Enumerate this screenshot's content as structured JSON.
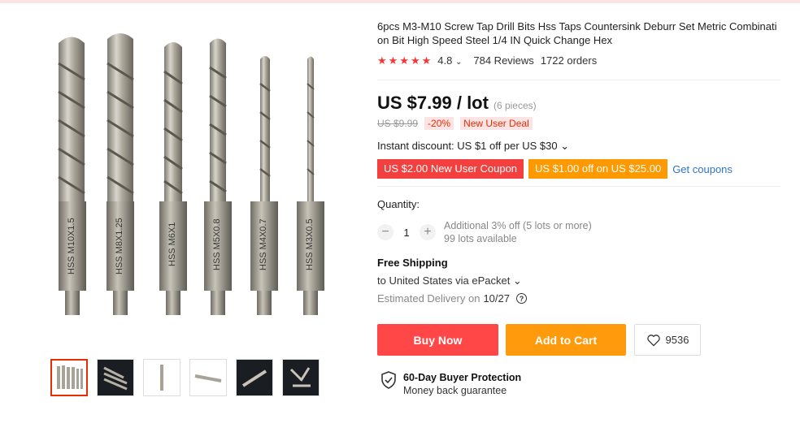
{
  "product": {
    "title": "6pcs M3-M10 Screw Tap Drill Bits Hss Taps Countersink Deburr Set Metric Combinati on Bit High Speed Steel 1/4 IN Quick Change Hex",
    "rating": "4.8",
    "rating_chevron": "⌄",
    "reviews": "784 Reviews",
    "orders": "1722 orders",
    "stars": 5,
    "bit_labels": [
      "HSS M10X1.5",
      "HSS M8X1.25",
      "HSS M6X1",
      "HSS M5X0.8",
      "HSS M4X0.7",
      "HSS M3X0.5"
    ]
  },
  "pricing": {
    "price": "US $7.99 / lot",
    "pieces": "(6 pieces)",
    "old_price": "US $9.99",
    "discount": "-20%",
    "deal": "New User Deal",
    "instant_discount": "Instant discount: US $1 off per US $30 ⌄",
    "coupon_red": "US $2.00 New User Coupon",
    "coupon_orange": "US $1.00 off on US $25.00",
    "get_coupons": "Get coupons"
  },
  "quantity": {
    "label": "Quantity:",
    "minus": "−",
    "value": "1",
    "plus": "+",
    "info1": "Additional 3% off (5 lots or more)",
    "info2": "99 lots available"
  },
  "shipping": {
    "title": "Free Shipping",
    "to": "to United States via ePacket ⌄",
    "delivery_label": "Estimated Delivery on",
    "delivery_date": "10/27"
  },
  "actions": {
    "buy_now": "Buy Now",
    "add_to_cart": "Add to Cart",
    "wishlist_count": "9536"
  },
  "protection": {
    "title": "60-Day Buyer Protection",
    "subtitle": "Money back guarantee"
  },
  "colors": {
    "accent_red": "#ff4747",
    "accent_orange": "#ff9a0c",
    "link_blue": "#2f74c8"
  }
}
